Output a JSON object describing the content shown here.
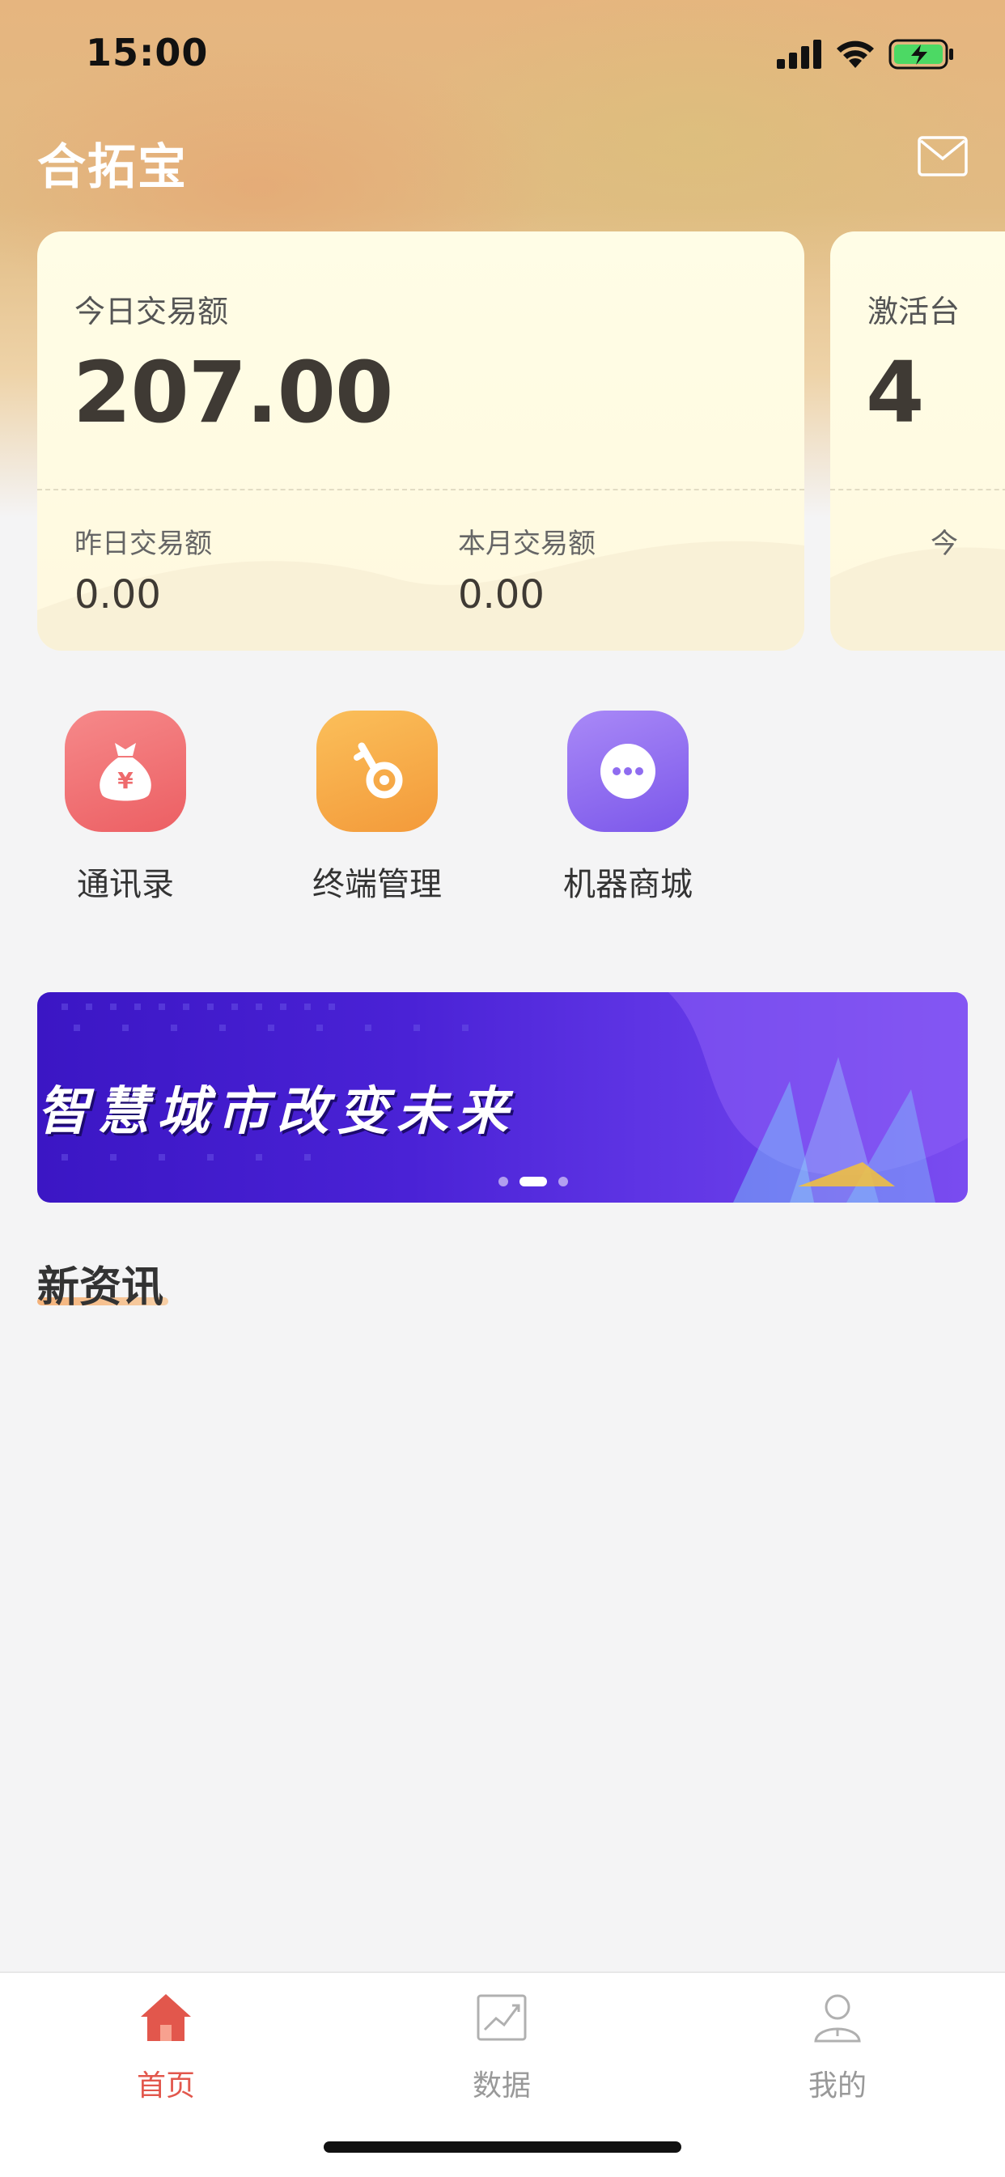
{
  "status_bar": {
    "time": "15:00"
  },
  "header": {
    "title": "合拓宝",
    "mail_icon": "mail-icon"
  },
  "cards": [
    {
      "label": "今日交易额",
      "value": "207.00",
      "sub": [
        {
          "label": "昨日交易额",
          "value": "0.00"
        },
        {
          "label": "本月交易额",
          "value": "0.00"
        }
      ]
    },
    {
      "label": "激活台",
      "value": "4",
      "sub": [
        {
          "label": "今"
        }
      ]
    }
  ],
  "quick_menu": [
    {
      "label": "通讯录",
      "icon": "money-bag-icon",
      "color": "#ef6f70"
    },
    {
      "label": "终端管理",
      "icon": "key-icon",
      "color": "#f6a94a"
    },
    {
      "label": "机器商城",
      "icon": "more-dots-icon",
      "color": "#8f6cf0"
    }
  ],
  "banner": {
    "text": "智慧城市改变未来",
    "slide_index": 1,
    "slide_count": 3
  },
  "news": {
    "title": "新资讯"
  },
  "tab_bar": {
    "active_color": "#e2574c",
    "tabs": [
      {
        "label": "首页",
        "icon": "home-icon",
        "active": true
      },
      {
        "label": "数据",
        "icon": "chart-icon",
        "active": false
      },
      {
        "label": "我的",
        "icon": "user-icon",
        "active": false
      }
    ]
  }
}
